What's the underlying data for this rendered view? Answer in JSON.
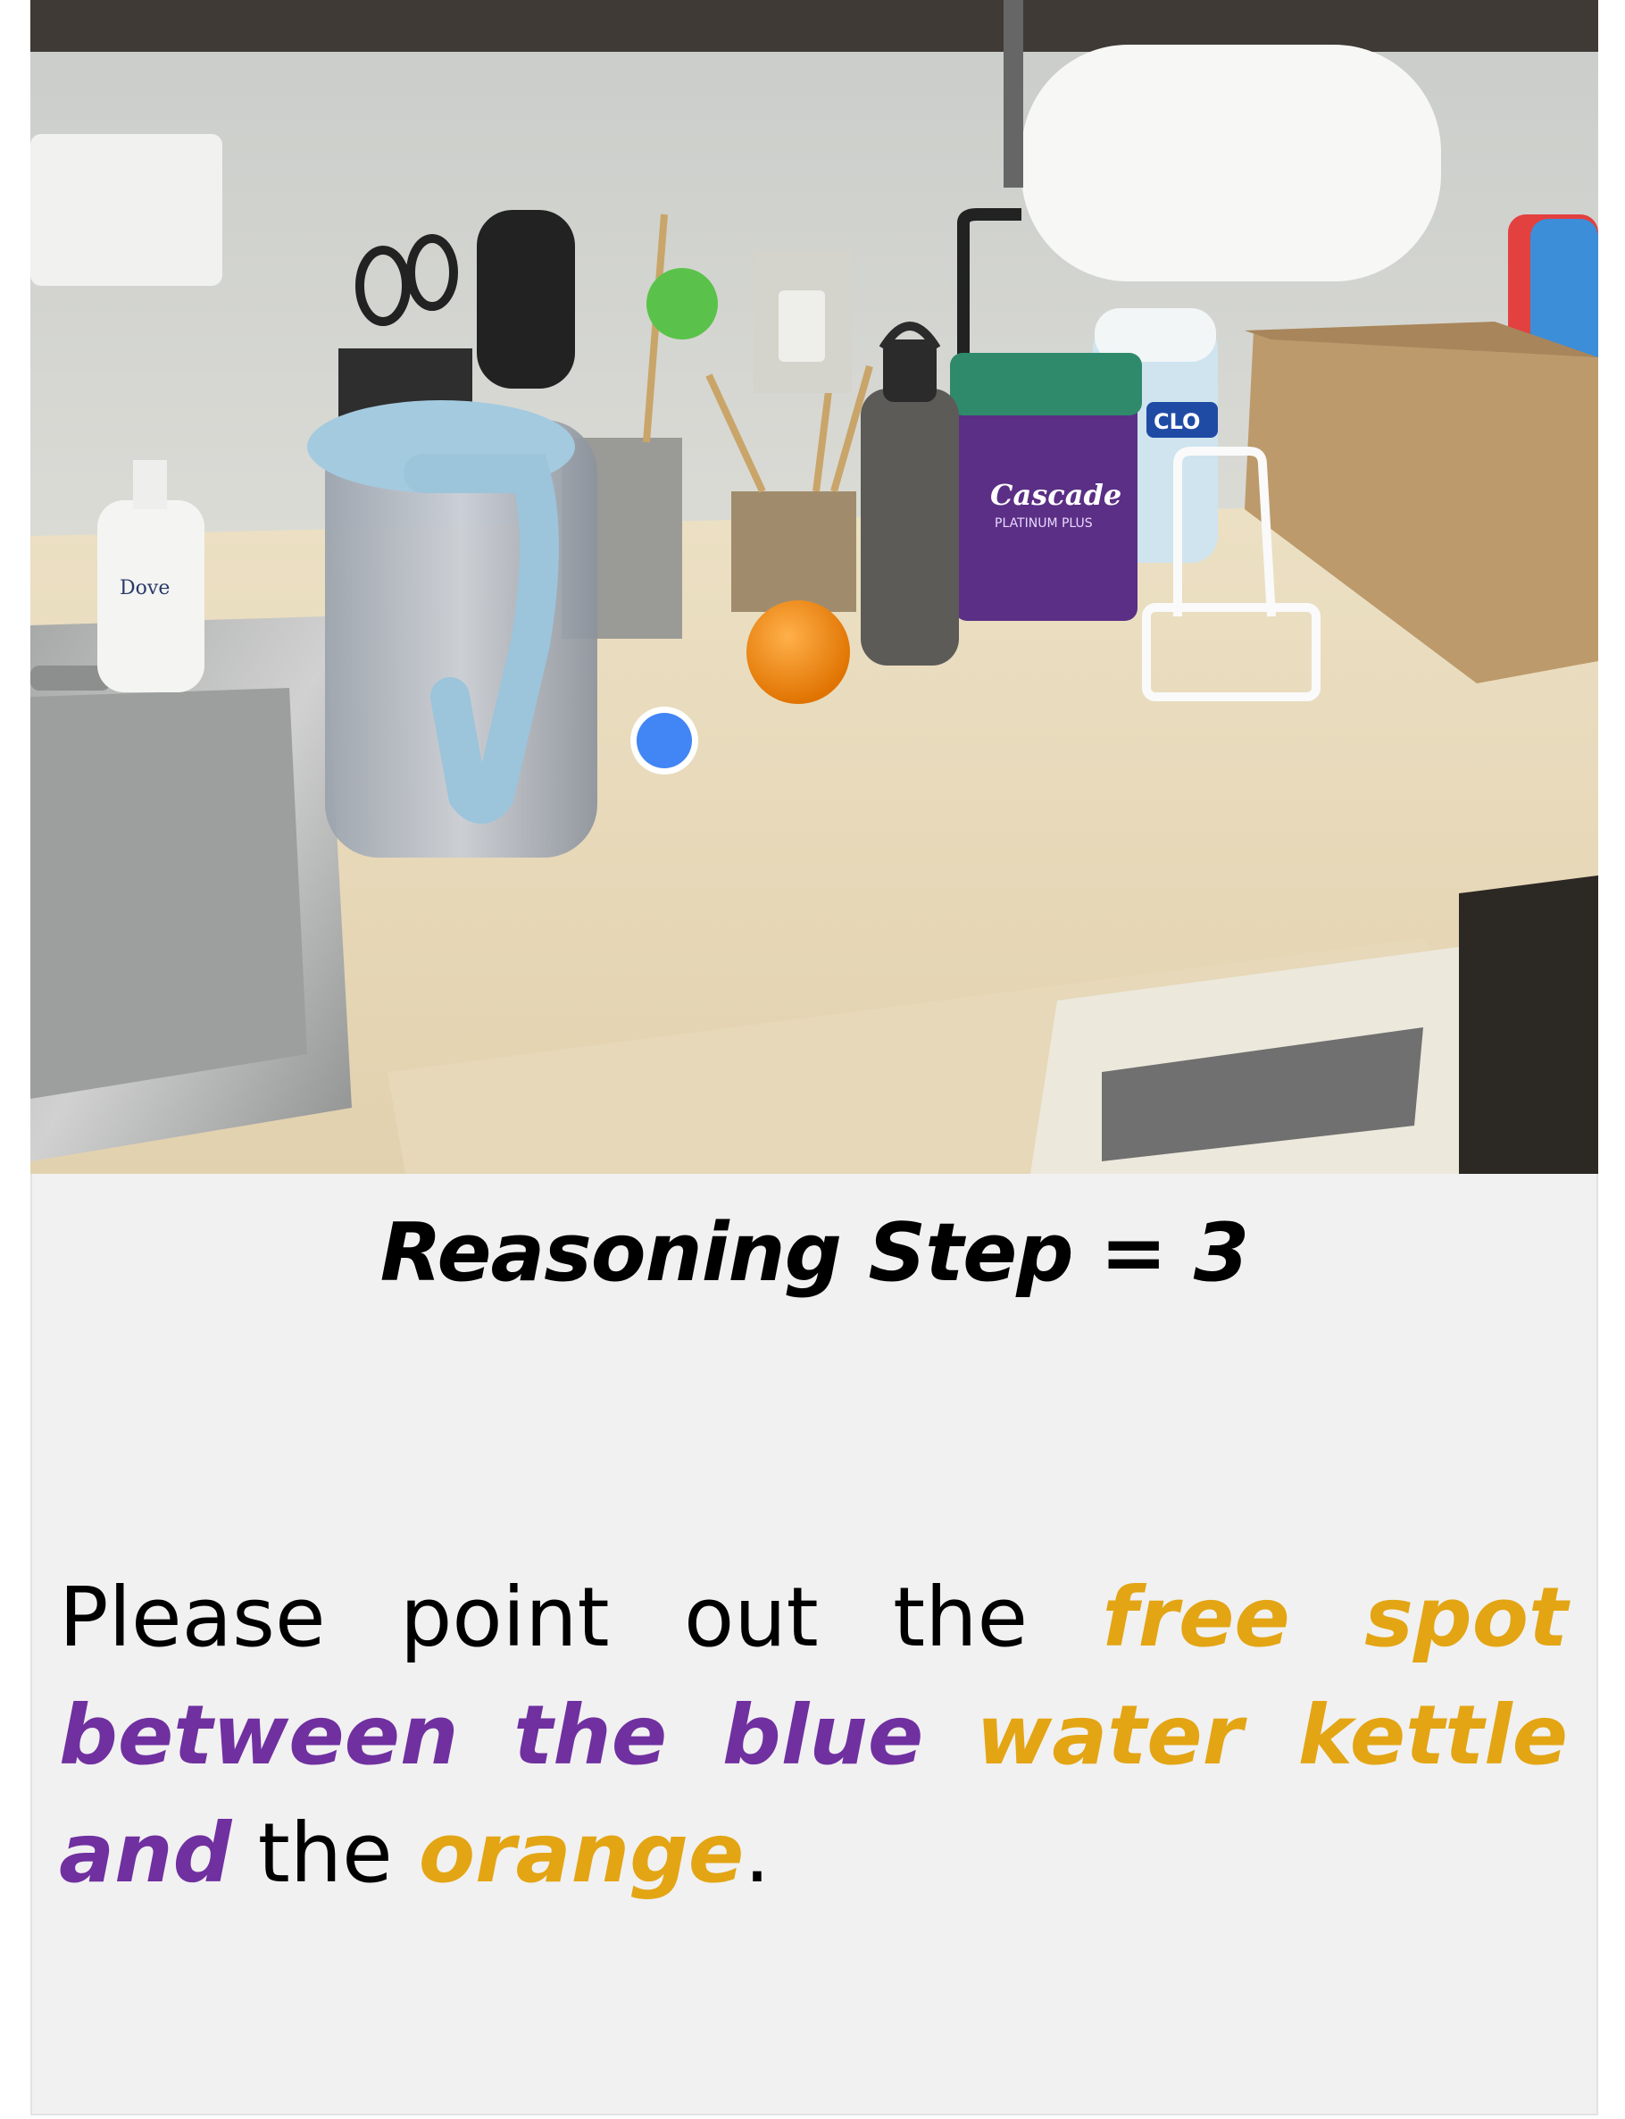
{
  "photo": {
    "labels": {
      "soap": "Dove",
      "detergent": "Cascade",
      "detergent_sub": "PLATINUM PLUS",
      "wipes": "CLO"
    },
    "marker_color": "#4285f4"
  },
  "caption": {
    "step_label": "Reasoning Step = 3"
  },
  "prompt": {
    "w1": "Please",
    "w2": "point",
    "w3": "out",
    "w4": "the",
    "w5": "free",
    "w6": "spot",
    "w7": "between the blue",
    "w8": "water kettle",
    "w9": "and",
    "w10": "the",
    "w11": "orange",
    "w12": "."
  },
  "colors": {
    "highlight_object": "#e3a514",
    "highlight_relation": "#7030a0"
  }
}
